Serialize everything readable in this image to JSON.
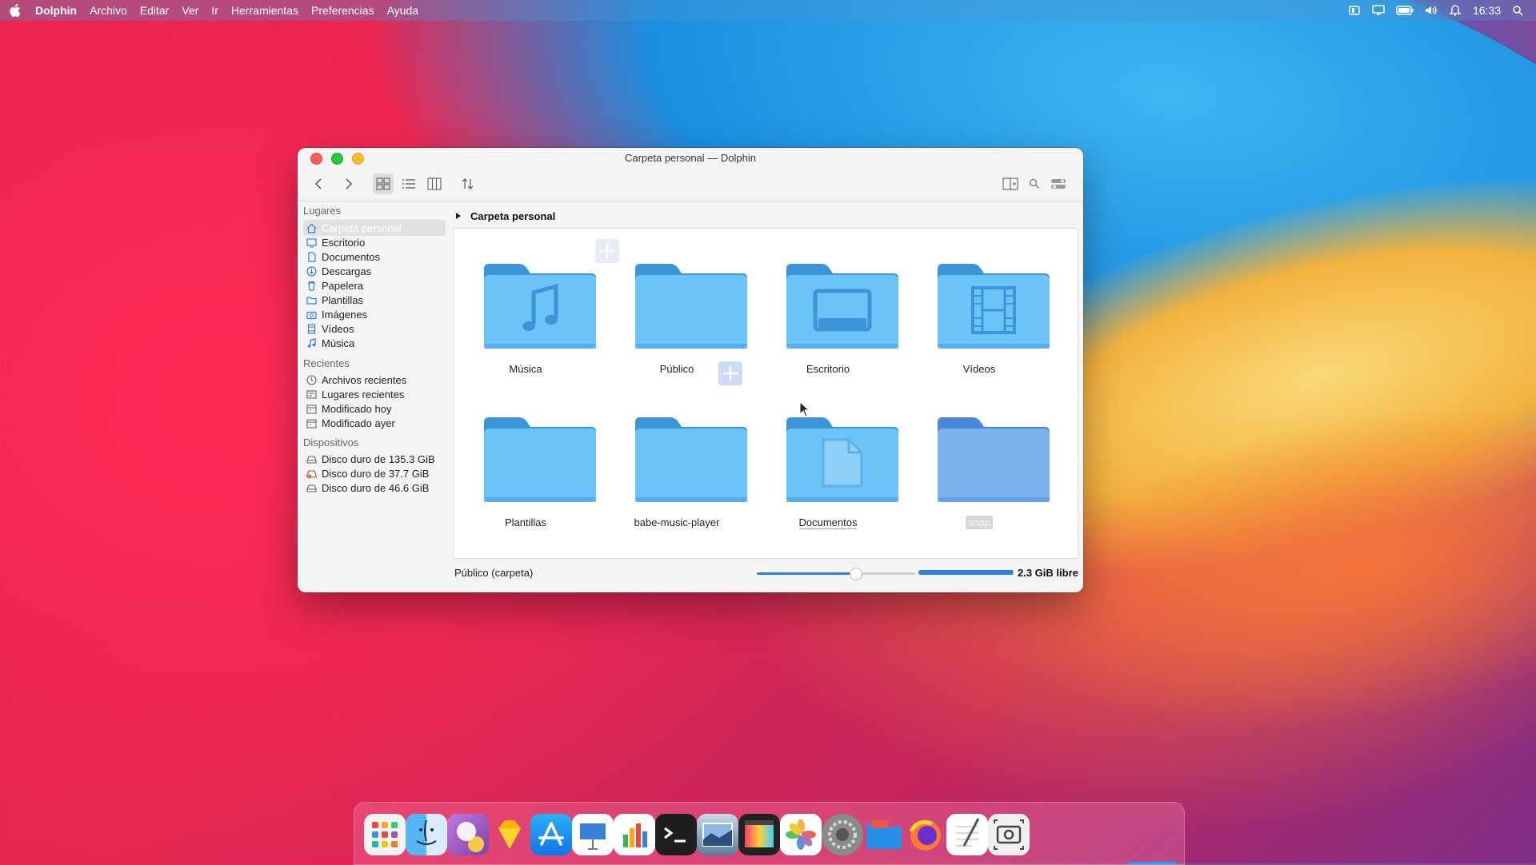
{
  "menubar": {
    "app_name": "Dolphin",
    "items": [
      "Archivo",
      "Editar",
      "Ver",
      "Ir",
      "Herramientas",
      "Preferencias",
      "Ayuda"
    ],
    "clock": "16:33"
  },
  "window": {
    "title": "Carpeta personal — Dolphin",
    "breadcrumb": "Carpeta personal"
  },
  "sidebar": {
    "places_heading": "Lugares",
    "places": [
      {
        "label": "Carpeta personal",
        "icon": "home-icon",
        "selected": true
      },
      {
        "label": "Escritorio",
        "icon": "desktop-icon"
      },
      {
        "label": "Documentos",
        "icon": "documents-icon"
      },
      {
        "label": "Descargas",
        "icon": "downloads-icon"
      },
      {
        "label": "Papelera",
        "icon": "trash-icon"
      },
      {
        "label": "Plantillas",
        "icon": "folder-icon"
      },
      {
        "label": "Imágenes",
        "icon": "camera-icon"
      },
      {
        "label": "Vídeos",
        "icon": "film-icon"
      },
      {
        "label": "Música",
        "icon": "music-icon"
      }
    ],
    "recent_heading": "Recientes",
    "recent": [
      {
        "label": "Archivos recientes",
        "icon": "clock-icon"
      },
      {
        "label": "Lugares recientes",
        "icon": "recent-places-icon"
      },
      {
        "label": "Modificado hoy",
        "icon": "calendar-icon"
      },
      {
        "label": "Modificado ayer",
        "icon": "calendar-icon"
      }
    ],
    "devices_heading": "Dispositivos",
    "devices": [
      {
        "label": "Disco duro de 135.3 GiB",
        "icon": "drive-icon"
      },
      {
        "label": "Disco duro de 37.7 GiB",
        "icon": "drive-warning-icon"
      },
      {
        "label": "Disco duro de 46.6 GiB",
        "icon": "drive-icon"
      }
    ]
  },
  "folders": [
    {
      "name": "Música",
      "emblem": "music-note"
    },
    {
      "name": "Público",
      "emblem": "none"
    },
    {
      "name": "Escritorio",
      "emblem": "desktop"
    },
    {
      "name": "Vídeos",
      "emblem": "film"
    },
    {
      "name": "Plantillas",
      "emblem": "none"
    },
    {
      "name": "babe-music-player",
      "emblem": "none"
    },
    {
      "name": "Documentos",
      "emblem": "document"
    },
    {
      "name": "snap",
      "emblem": "none",
      "selected": true
    }
  ],
  "status": {
    "text": "Público (carpeta)",
    "zoom_fraction": 0.62,
    "free_fraction": 0.98,
    "free_text": "2.3 GiB libre"
  },
  "colors": {
    "folder_body": "#6cc3f7",
    "folder_tab": "#3d95d9",
    "accent": "#2f7de1"
  },
  "dock": {
    "apps": [
      "launchpad-icon",
      "finder-icon",
      "discover-icon",
      "sketch-icon",
      "app-store-icon",
      "keynote-icon",
      "numbers-icon",
      "terminal-icon",
      "preview-icon",
      "final-cut-icon",
      "photos-icon",
      "system-preferences-icon",
      "files-icon",
      "firefox-icon",
      "textedit-icon",
      "screenshot-icon"
    ]
  }
}
